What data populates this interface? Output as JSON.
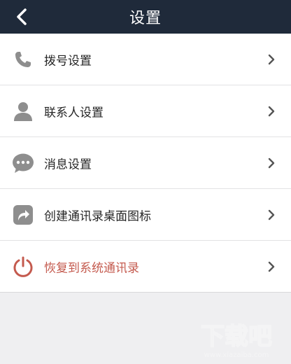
{
  "header": {
    "title": "设置"
  },
  "menu": [
    {
      "label": "拨号设置",
      "icon": "phone-icon"
    },
    {
      "label": "联系人设置",
      "icon": "person-icon"
    },
    {
      "label": "消息设置",
      "icon": "message-icon"
    },
    {
      "label": "创建通讯录桌面图标",
      "icon": "share-icon"
    },
    {
      "label": "恢复到系统通讯录",
      "icon": "power-icon"
    }
  ],
  "watermark": {
    "text": "下载吧",
    "url": "www.xiazaiba.com"
  },
  "colors": {
    "header": "#1f2a3a",
    "danger": "#c45a4e",
    "icon": "#8e8e8e",
    "background": "#efeff1"
  }
}
